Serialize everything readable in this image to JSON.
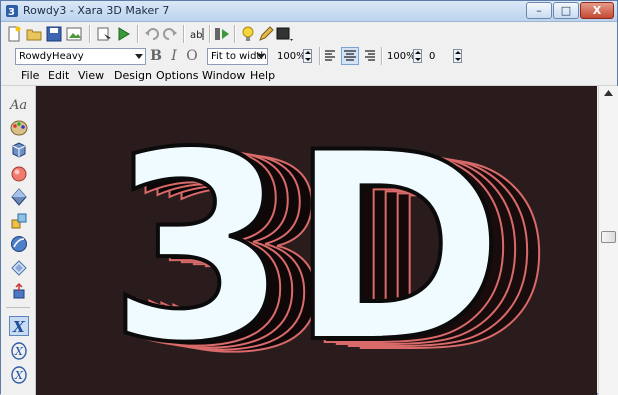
{
  "window": {
    "title": "Rowdy3 - Xara 3D Maker 7",
    "buttons": {
      "minimize": "–",
      "maximize": "□",
      "close": "X"
    }
  },
  "toolbar": {
    "font": "RowdyHeavy",
    "bold": "B",
    "italic": "I",
    "outline": "O",
    "fit_mode": "Fit to width",
    "scale": "100%",
    "spacing": "100%",
    "spacing_offset": "0"
  },
  "menu": [
    "File",
    "Edit",
    "View",
    "Design",
    "Options",
    "Window",
    "Help"
  ],
  "left_tools": [
    "text-tool-icon",
    "color-tool-icon",
    "bevel-tool-icon",
    "lighting-tool-icon",
    "shadow-tool-icon",
    "texture-tool-icon",
    "extrude-tool-icon",
    "animation-tool-icon",
    "export-tool-icon"
  ],
  "canvas": {
    "text": "3D",
    "background_color": "#2a1c1c",
    "text_color": "#f0fbff",
    "extrude_color": "#d96a6a"
  },
  "accent_colors": {
    "title_bar": "#bcd3ee",
    "close_button": "#c24a33"
  }
}
